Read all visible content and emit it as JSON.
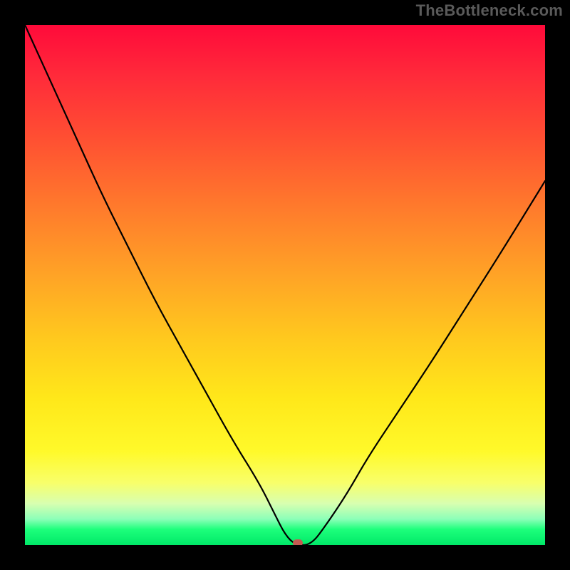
{
  "watermark": "TheBottleneck.com",
  "chart_data": {
    "type": "line",
    "title": "",
    "xlabel": "",
    "ylabel": "",
    "xlim": [
      0,
      100
    ],
    "ylim": [
      0,
      100
    ],
    "grid": false,
    "legend": false,
    "series": [
      {
        "name": "bottleneck-curve",
        "x": [
          0,
          5,
          10,
          15,
          20,
          25,
          30,
          35,
          40,
          45,
          48,
          50,
          52,
          55,
          58,
          62,
          66,
          72,
          78,
          85,
          92,
          100
        ],
        "values": [
          100,
          89,
          78,
          67,
          57,
          47,
          38,
          29,
          20,
          12,
          6,
          2,
          0,
          0,
          4,
          10,
          17,
          26,
          35,
          46,
          57,
          70
        ]
      }
    ],
    "marker": {
      "x": 52.5,
      "y": 0
    },
    "background_gradient": {
      "top": "#ff0a3a",
      "mid": "#ffe81a",
      "bottom": "#00e868"
    }
  }
}
